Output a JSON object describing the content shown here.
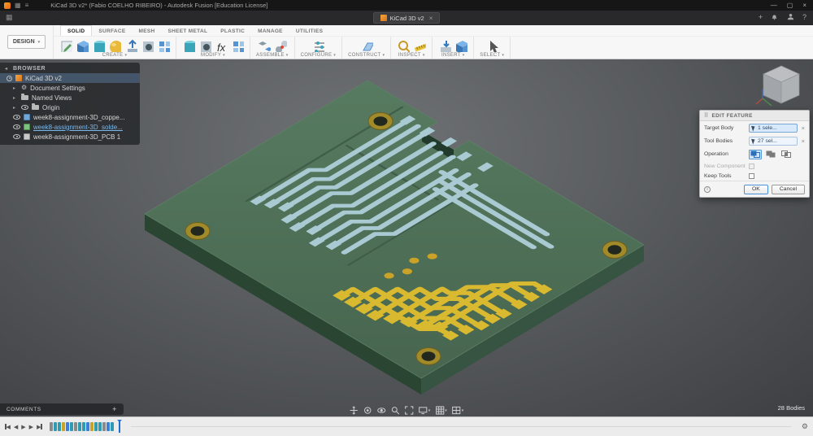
{
  "titlebar": {
    "title": "KiCad 3D v2* (Fabio COELHO RIBEIRO) - Autodesk Fusion [Education License]"
  },
  "tabbar": {
    "tab_label": "KiCad 3D v2"
  },
  "ribbon": {
    "design_label": "DESIGN",
    "tabs": [
      {
        "label": "SOLID",
        "active": true
      },
      {
        "label": "SURFACE"
      },
      {
        "label": "MESH"
      },
      {
        "label": "SHEET METAL"
      },
      {
        "label": "PLASTIC"
      },
      {
        "label": "MANAGE"
      },
      {
        "label": "UTILITIES"
      }
    ],
    "groups": [
      {
        "label": "CREATE"
      },
      {
        "label": "MODIFY"
      },
      {
        "label": "ASSEMBLE"
      },
      {
        "label": "CONFIGURE"
      },
      {
        "label": "CONSTRUCT"
      },
      {
        "label": "INSPECT"
      },
      {
        "label": "INSERT"
      },
      {
        "label": "SELECT"
      }
    ]
  },
  "browser": {
    "header": "BROWSER",
    "items": [
      {
        "label": "KiCad 3D v2",
        "selected": true
      },
      {
        "label": "Document Settings"
      },
      {
        "label": "Named Views"
      },
      {
        "label": "Origin"
      },
      {
        "label": "week8-assignment-3D_coppe..."
      },
      {
        "label": "week8-assignment-3D_solde...",
        "editing": true
      },
      {
        "label": "week8-assignment-3D_PCB 1"
      }
    ]
  },
  "dialog": {
    "title": "EDIT FEATURE",
    "rows": {
      "target_body_label": "Target Body",
      "target_body_value": "1 sele...",
      "tool_bodies_label": "Tool Bodies",
      "tool_bodies_value": "27 sel...",
      "operation_label": "Operation",
      "new_component_label": "New Component",
      "keep_tools_label": "Keep Tools"
    },
    "buttons": {
      "ok": "OK",
      "cancel": "Cancel"
    }
  },
  "canvas": {
    "bodies_count": "28 Bodies",
    "comments_label": "COMMENTS",
    "nav_icons": [
      "pan-icon",
      "orbit-icon",
      "look-at-icon",
      "zoom-icon",
      "fit-icon",
      "display-settings-icon",
      "grid-settings-icon",
      "viewports-icon"
    ]
  },
  "timeline": {
    "playback_icons": [
      "skip-start-icon",
      "step-back-icon",
      "play-icon",
      "step-forward-icon",
      "skip-end-icon"
    ],
    "feature_icons": [
      "#8a8a8a",
      "#2f9bb3",
      "#2f9bb3",
      "#c9a227",
      "#3d7edb",
      "#2f9bb3",
      "#8a8a8a",
      "#2f9bb3",
      "#2f9bb3",
      "#3d7edb",
      "#c9a227",
      "#2f9bb3",
      "#2f9bb3",
      "#8a8a8a",
      "#3d7edb",
      "#2f9bb3"
    ]
  },
  "colors": {
    "board_top": "#4e7057",
    "board_side": "#2e4836",
    "trace_teal": "#a9cad2",
    "trace_yellow": "#d9b92f",
    "hole_ring": "#a08a2a",
    "accent_blue": "#1f6fd0"
  }
}
